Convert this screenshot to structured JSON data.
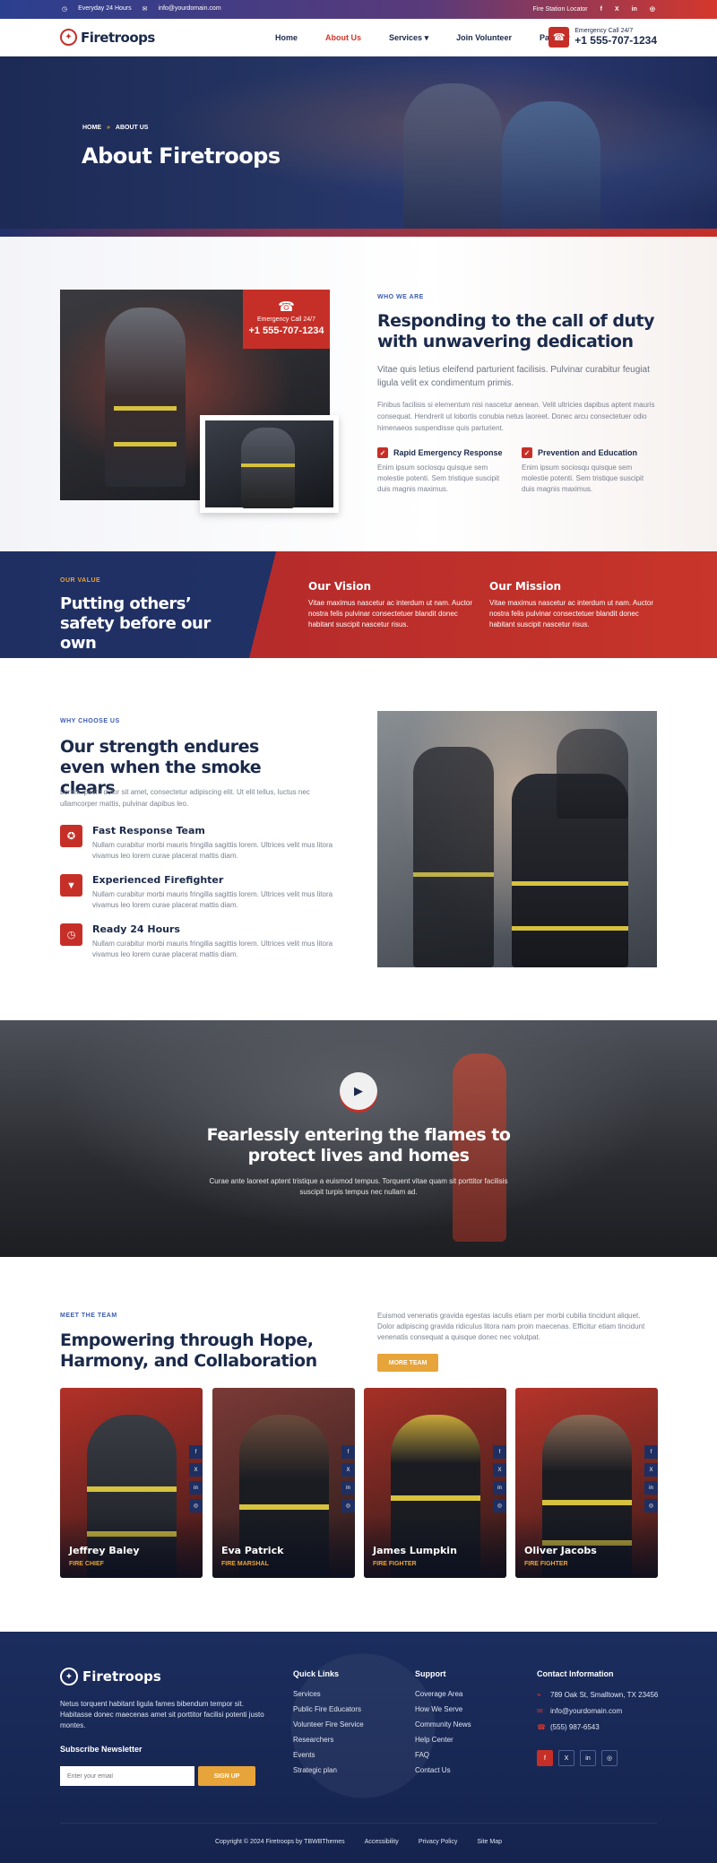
{
  "topbar": {
    "hours": "Everyday 24 Hours",
    "email": "info@yourdomain.com",
    "locator": "Fire Station Locator",
    "socials": [
      "f",
      "X",
      "in",
      "◎"
    ]
  },
  "header": {
    "logo": "Firetroops",
    "nav": [
      "Home",
      "About Us",
      "Services",
      "Join Volunteer",
      "Pages"
    ],
    "call_label": "Emergency Call 24/7",
    "call_number": "+1 555-707-1234"
  },
  "hero": {
    "breadcrumb_home": "HOME",
    "breadcrumb_current": "ABOUT US",
    "title": "About Firetroops"
  },
  "about": {
    "emergency_label": "Emergency Call 24/7",
    "emergency_number": "+1 555-707-1234",
    "tag": "WHO WE ARE",
    "heading": "Responding to the call of duty with unwavering dedication",
    "lead": "Vitae quis letius eleifend parturient facilisis. Pulvinar curabitur feugiat ligula velit ex condimentum primis.",
    "paragraph": "Finibus facilisis si elementum nisi nascetur aenean. Velit ultricies dapibus aptent mauris consequat. Hendrerit ut lobortis conubia netus laoreet. Donec arcu consectetuer odio himenaeos suspendisse quis parturient.",
    "features": [
      {
        "title": "Rapid Emergency Response",
        "text": "Enim ipsum sociosqu quisque sem molestie potenti. Sem tristique suscipit duis magnis maximus."
      },
      {
        "title": "Prevention and Education",
        "text": "Enim ipsum sociosqu quisque sem molestie potenti. Sem tristique suscipit duis magnis maximus."
      }
    ]
  },
  "value": {
    "tag": "OUR VALUE",
    "heading": "Putting others’ safety before our own",
    "vision_title": "Our Vision",
    "vision_text": "Vitae maximus nascetur ac interdum ut nam. Auctor nostra felis pulvinar consectetuer blandit donec habitant suscipit nascetur risus.",
    "mission_title": "Our Mission",
    "mission_text": "Vitae maximus nascetur ac interdum ut nam. Auctor nostra felis pulvinar consectetuer blandit donec habitant suscipit nascetur risus."
  },
  "why": {
    "tag": "WHY CHOOSE US",
    "heading": "Our strength endures even when the smoke clears",
    "paragraph": "Lorem ipsum dolor sit amet, consectetur adipiscing elit. Ut elit tellus, luctus nec ullamcorper mattis, pulvinar dapibus leo.",
    "items": [
      {
        "title": "Fast Response Team",
        "text": "Nullam curabitur morbi mauris fringilla sagittis lorem. Ultrices velit mus litora vivamus leo lorem curae placerat mattis diam."
      },
      {
        "title": "Experienced Firefighter",
        "text": "Nullam curabitur morbi mauris fringilla sagittis lorem. Ultrices velit mus litora vivamus leo lorem curae placerat mattis diam."
      },
      {
        "title": "Ready 24 Hours",
        "text": "Nullam curabitur morbi mauris fringilla sagittis lorem. Ultrices velit mus litora vivamus leo lorem curae placerat mattis diam."
      }
    ]
  },
  "video": {
    "heading": "Fearlessly entering the flames to protect lives and homes",
    "text": "Curae ante laoreet aptent tristique a euismod tempus. Torquent vitae quam sit porttitor facilisis suscipit turpis tempus nec nullam ad."
  },
  "team": {
    "tag": "MEET THE TEAM",
    "heading": "Empowering through Hope, Harmony, and Collaboration",
    "text": "Euismod venenatis gravida egestas iaculis etiam per morbi cubilia tincidunt aliquet. Dolor adipiscing gravida ridiculus litora nam proin maecenas. Efficitur etiam tincidunt venenatis consequat a quisque donec nec volutpat.",
    "button": "MORE TEAM",
    "members": [
      {
        "name": "Jeffrey Baley",
        "role": "FIRE CHIEF"
      },
      {
        "name": "Eva Patrick",
        "role": "FIRE MARSHAL"
      },
      {
        "name": "James Lumpkin",
        "role": "FIRE FIGHTER"
      },
      {
        "name": "Oliver Jacobs",
        "role": "FIRE FIGHTER"
      }
    ],
    "member_socials": [
      "f",
      "X",
      "in",
      "◎"
    ]
  },
  "footer": {
    "logo": "Firetroops",
    "about": "Netus torquent habitant ligula fames bibendum tempor sit. Habitasse donec maecenas amet sit porttitor facilisi potenti justo montes.",
    "newsletter_title": "Subscribe Newsletter",
    "email_placeholder": "Enter your email",
    "signup": "SIGN UP",
    "quick_title": "Quick Links",
    "quick_links": [
      "Services",
      "Public Fire Educators",
      "Volunteer Fire Service",
      "Researchers",
      "Events",
      "Strategic plan"
    ],
    "support_title": "Support",
    "support_links": [
      "Coverage Area",
      "How We Serve",
      "Community News",
      "Help Center",
      "FAQ",
      "Contact Us"
    ],
    "contact_title": "Contact Information",
    "address": "789 Oak St, Smalltown, TX 23456",
    "email": "info@yourdomain.com",
    "phone": "(555) 987-6543",
    "socials": [
      "f",
      "X",
      "in",
      "◎"
    ],
    "copyright": "Copyright © 2024 Firetroops by TBWBThemes",
    "bottom_links": [
      "Accessibility",
      "Privacy Policy",
      "Site Map"
    ]
  }
}
